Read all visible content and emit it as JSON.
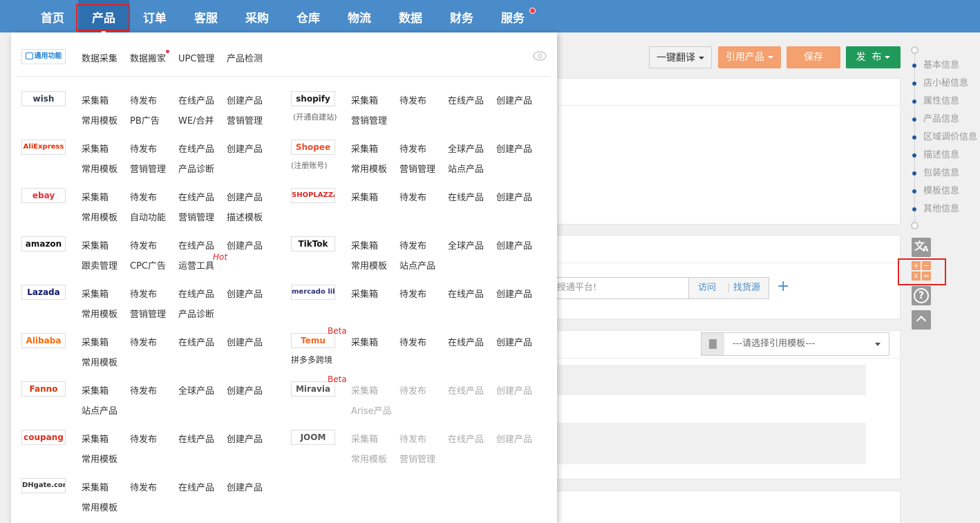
{
  "topnav": {
    "items": [
      "首页",
      "产品",
      "订单",
      "客服",
      "采购",
      "仓库",
      "物流",
      "数据",
      "财务",
      "服务"
    ],
    "active_index": 1
  },
  "toolbar": {
    "translate": "一键翻译",
    "cite_product": "引用产品",
    "save": "保存",
    "publish": "发  布"
  },
  "background": {
    "platform_placeholder": "授通平台!",
    "visit": "访问",
    "find_source": "找货源",
    "template_placeholder": "---请选择引用模板---"
  },
  "right_rail": {
    "items": [
      "基本信息",
      "店小秘信息",
      "属性信息",
      "产品信息",
      "区域调价信息",
      "描述信息",
      "包装信息",
      "模板信息",
      "其他信息"
    ]
  },
  "panel": {
    "general_logo": "通用功能",
    "general_links": [
      "数据采集",
      "数据搬家",
      "UPC管理",
      "产品检测"
    ],
    "left_platforms": [
      {
        "logo": "wish",
        "color": "#2d3e50",
        "row1": [
          "采集箱",
          "待发布",
          "在线产品",
          "创建产品"
        ],
        "row2": [
          "常用模板",
          "PB广告",
          "WE/合并",
          "营销管理"
        ]
      },
      {
        "logo": "AliExpress",
        "color": "#e62e04",
        "row1": [
          "采集箱",
          "待发布",
          "在线产品",
          "创建产品"
        ],
        "row2": [
          "常用模板",
          "营销管理",
          "产品诊断"
        ]
      },
      {
        "logo": "ebay",
        "color": "#e53238",
        "row1": [
          "采集箱",
          "待发布",
          "在线产品",
          "创建产品"
        ],
        "row2": [
          "常用模板",
          "自动功能",
          "营销管理",
          "描述模板"
        ]
      },
      {
        "logo": "amazon",
        "color": "#111111",
        "row1": [
          "采集箱",
          "待发布",
          "在线产品",
          "创建产品"
        ],
        "row2": [
          "跟卖管理",
          "CPC广告",
          "运营工具"
        ],
        "tag": "Hot"
      },
      {
        "logo": "Lazada",
        "color": "#0f146d",
        "row1": [
          "采集箱",
          "待发布",
          "在线产品",
          "创建产品"
        ],
        "row2": [
          "常用模板",
          "营销管理",
          "产品诊断"
        ]
      },
      {
        "logo": "Alibaba",
        "color": "#ff6a00",
        "row1": [
          "采集箱",
          "待发布",
          "在线产品",
          "创建产品"
        ],
        "row2": [
          "常用模板"
        ]
      },
      {
        "logo": "Fanno",
        "color": "#d4380d",
        "row1": [
          "采集箱",
          "待发布",
          "全球产品",
          "创建产品"
        ],
        "row2": [
          "站点产品"
        ]
      },
      {
        "logo": "coupang",
        "color": "#e0301e",
        "row1": [
          "采集箱",
          "待发布",
          "在线产品",
          "创建产品"
        ],
        "row2": [
          "常用模板"
        ]
      },
      {
        "logo": "DHgate.com",
        "color": "#333333",
        "row1": [
          "采集箱",
          "待发布",
          "在线产品",
          "创建产品"
        ],
        "row2": [
          "常用模板"
        ]
      }
    ],
    "right_platforms": [
      {
        "logo": "shopify",
        "color": "#1a1a1a",
        "sub": "(开通自建站)",
        "row1": [
          "采集箱",
          "待发布",
          "在线产品",
          "创建产品"
        ],
        "row2": [
          "营销管理"
        ]
      },
      {
        "logo": "Shopee",
        "color": "#ee4d2d",
        "sub": "(注册账号)",
        "row1": [
          "采集箱",
          "待发布",
          "全球产品",
          "创建产品"
        ],
        "row2": [
          "常用模板",
          "营销管理",
          "站点产品"
        ]
      },
      {
        "logo": "SHOPLAZZA",
        "color": "#e02424",
        "row1": [
          "采集箱",
          "待发布",
          "在线产品",
          "创建产品"
        ],
        "row2": []
      },
      {
        "logo": "TikTok",
        "color": "#111111",
        "row1": [
          "采集箱",
          "待发布",
          "全球产品",
          "创建产品"
        ],
        "row2": [
          "常用模板",
          "站点产品"
        ]
      },
      {
        "logo": "mercado libre",
        "color": "#2d3277",
        "row1": [
          "采集箱",
          "待发布",
          "在线产品",
          "创建产品"
        ],
        "row2": []
      },
      {
        "logo": "Temu",
        "color": "#f26722",
        "sub": "拼多多跨境",
        "tag": "Beta",
        "row1": [
          "采集箱",
          "待发布",
          "在线产品",
          "创建产品"
        ],
        "row2": []
      },
      {
        "logo": "Miravia",
        "color": "#555555",
        "tag": "Beta",
        "disabled": true,
        "row1": [
          "采集箱",
          "待发布",
          "在线产品",
          "创建产品"
        ],
        "row2": [
          "Arise产品"
        ]
      },
      {
        "logo": "JOOM",
        "color": "#555555",
        "disabled": true,
        "row1": [
          "采集箱",
          "待发布",
          "在线产品",
          "创建产品"
        ],
        "row2": [
          "常用模板",
          "营销管理"
        ]
      }
    ]
  }
}
